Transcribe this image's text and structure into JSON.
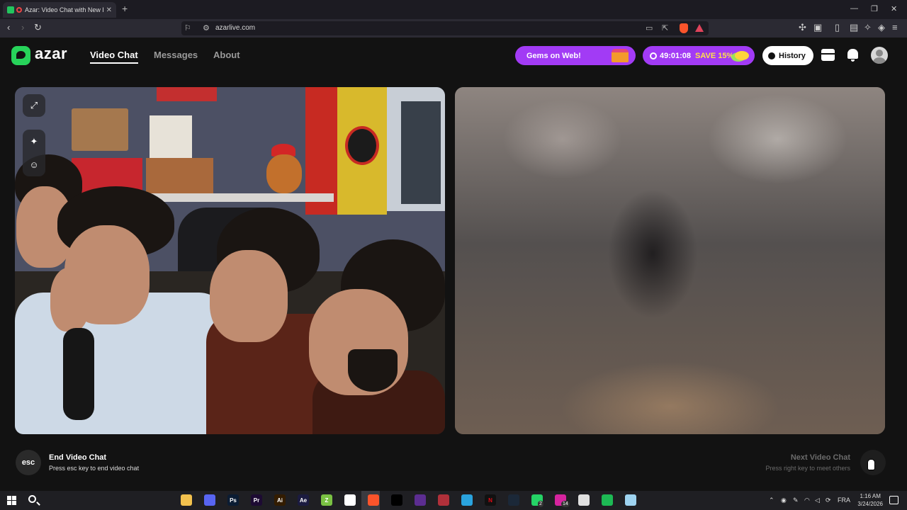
{
  "browser": {
    "tab_title": "Azar: Video Chat with New Pe",
    "tab_close": "✕",
    "new_tab": "+",
    "url": "azarlive.com",
    "controls": {
      "minimize": "—",
      "maximize": "❐",
      "close": "✕"
    }
  },
  "site": {
    "logo_text": "azar",
    "nav": [
      {
        "label": "Video Chat",
        "active": true
      },
      {
        "label": "Messages",
        "active": false
      },
      {
        "label": "About",
        "active": false
      }
    ],
    "gems_label": "Gems on Web!",
    "timer": "49:01:08",
    "save_label": "SAVE 15%",
    "history_label": "History"
  },
  "controls": {
    "esc_label": "esc",
    "end_title": "End Video Chat",
    "end_subtitle": "Press esc key to end video chat",
    "next_title": "Next Video Chat",
    "next_subtitle": "Press right key to meet others"
  },
  "taskbar": {
    "apps": [
      {
        "icon": "file-explorer-icon",
        "label": "",
        "color": "#f2c14e"
      },
      {
        "icon": "discord-icon",
        "label": "",
        "color": "#5865f2"
      },
      {
        "icon": "photoshop-icon",
        "label": "Ps",
        "color": "#0b1c33"
      },
      {
        "icon": "premiere-icon",
        "label": "Pr",
        "color": "#1d0b33"
      },
      {
        "icon": "illustrator-icon",
        "label": "Ai",
        "color": "#331c00"
      },
      {
        "icon": "after-effects-icon",
        "label": "Ae",
        "color": "#1b1b40"
      },
      {
        "icon": "app-z-icon",
        "label": "Z",
        "color": "#7ac143"
      },
      {
        "icon": "capcut-icon",
        "label": "",
        "color": "#ffffff"
      },
      {
        "icon": "brave-icon",
        "label": "",
        "color": "#fb542b"
      },
      {
        "icon": "tiktok-icon",
        "label": "",
        "color": "#000000"
      },
      {
        "icon": "visual-studio-icon",
        "label": "",
        "color": "#5c2d91"
      },
      {
        "icon": "game-app-icon",
        "label": "",
        "color": "#b0303a"
      },
      {
        "icon": "telegram-icon",
        "label": "",
        "color": "#2aa3de"
      },
      {
        "icon": "netflix-icon",
        "label": "N",
        "color": "#111111"
      },
      {
        "icon": "steam-icon",
        "label": "",
        "color": "#1b2838"
      },
      {
        "icon": "whatsapp-icon",
        "label": "",
        "color": "#25d366"
      },
      {
        "icon": "instagram-icon",
        "label": "",
        "color": "#d6249f"
      },
      {
        "icon": "opera-gx-icon",
        "label": "",
        "color": "#e0e0e0"
      },
      {
        "icon": "spotify-icon",
        "label": "",
        "color": "#1db954"
      },
      {
        "icon": "notes-icon",
        "label": "",
        "color": "#9ed3f0"
      }
    ],
    "badges": {
      "whatsapp": "2",
      "instagram": "14"
    },
    "language": "FRA",
    "time": "1:16 AM",
    "date": "3/24/2026"
  },
  "colors": {
    "brand_green": "#27d35a",
    "promo_purple": "#a23bf5",
    "save_yellow": "#ffe14a",
    "page_background": "#121212"
  }
}
